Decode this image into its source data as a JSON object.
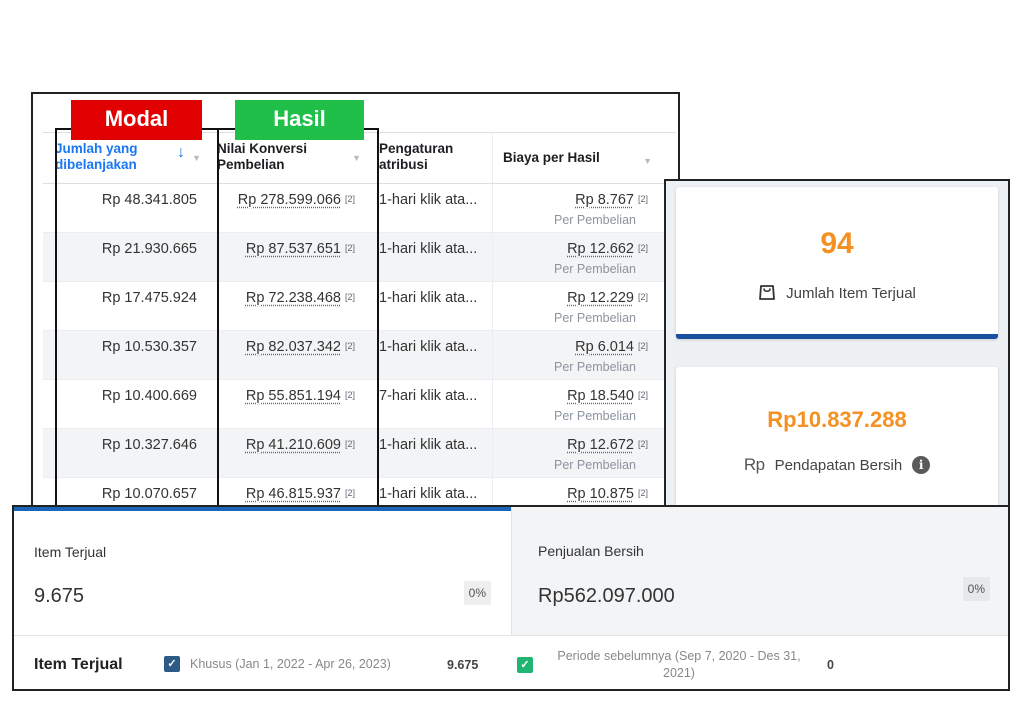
{
  "labels": {
    "modal": "Modal",
    "hasil": "Hasil"
  },
  "table": {
    "headers": [
      "Jumlah yang dibelanjakan",
      "Nilai Konversi Pembelian",
      "Pengaturan atribusi",
      "Biaya per Hasil"
    ],
    "sort_icon": "arrow-down-icon",
    "rows": [
      {
        "spend": "Rp 48.341.805",
        "conv_value": "Rp 278.599.066",
        "conv_ref": "[2]",
        "attribution": "1-hari klik ata...",
        "cost": "Rp 8.767",
        "cost_ref": "[2]",
        "cost_sub": "Per Pembelian"
      },
      {
        "spend": "Rp 21.930.665",
        "conv_value": "Rp 87.537.651",
        "conv_ref": "[2]",
        "attribution": "1-hari klik ata...",
        "cost": "Rp 12.662",
        "cost_ref": "[2]",
        "cost_sub": "Per Pembelian"
      },
      {
        "spend": "Rp 17.475.924",
        "conv_value": "Rp 72.238.468",
        "conv_ref": "[2]",
        "attribution": "1-hari klik ata...",
        "cost": "Rp 12.229",
        "cost_ref": "[2]",
        "cost_sub": "Per Pembelian"
      },
      {
        "spend": "Rp 10.530.357",
        "conv_value": "Rp 82.037.342",
        "conv_ref": "[2]",
        "attribution": "1-hari klik ata...",
        "cost": "Rp 6.014",
        "cost_ref": "[2]",
        "cost_sub": "Per Pembelian"
      },
      {
        "spend": "Rp 10.400.669",
        "conv_value": "Rp 55.851.194",
        "conv_ref": "[2]",
        "attribution": "7-hari klik ata...",
        "cost": "Rp 18.540",
        "cost_ref": "[2]",
        "cost_sub": "Per Pembelian"
      },
      {
        "spend": "Rp 10.327.646",
        "conv_value": "Rp 41.210.609",
        "conv_ref": "[2]",
        "attribution": "1-hari klik ata...",
        "cost": "Rp 12.672",
        "cost_ref": "[2]",
        "cost_sub": "Per Pembelian"
      },
      {
        "spend": "Rp 10.070.657",
        "conv_value": "Rp 46.815.937",
        "conv_ref": "[2]",
        "attribution": "1-hari klik ata...",
        "cost": "Rp 10.875",
        "cost_ref": "[2]",
        "cost_sub": ""
      }
    ]
  },
  "stats": {
    "items_sold": {
      "value": "94",
      "label": "Jumlah Item Terjual",
      "icon": "shopping-bag-icon"
    },
    "net_income": {
      "value": "Rp10.837.288",
      "label": "Pendapatan Bersih",
      "icon_text": "Rp",
      "info_icon": "info-icon",
      "info_glyph": "i"
    }
  },
  "summary": {
    "items": {
      "title": "Item Terjual",
      "value": "9.675",
      "change": "0%"
    },
    "sales": {
      "title": "Penjualan Bersih",
      "value": "Rp562.097.000",
      "change": "0%"
    },
    "legend": {
      "title": "Item Terjual",
      "custom": {
        "label": "Khusus (Jan 1, 2022 - Apr 26, 2023)",
        "value": "9.675",
        "check": "✓"
      },
      "previous": {
        "label": "Periode sebelumnya (Sep 7, 2020 - Des 31, 2021)",
        "value": "0",
        "check": "✓"
      }
    }
  },
  "colors": {
    "accent_blue": "#1877f2",
    "orange": "#f59122",
    "navy_bar": "#1a4e9e",
    "modal_red": "#e00000",
    "hasil_green": "#1fbf4a"
  }
}
